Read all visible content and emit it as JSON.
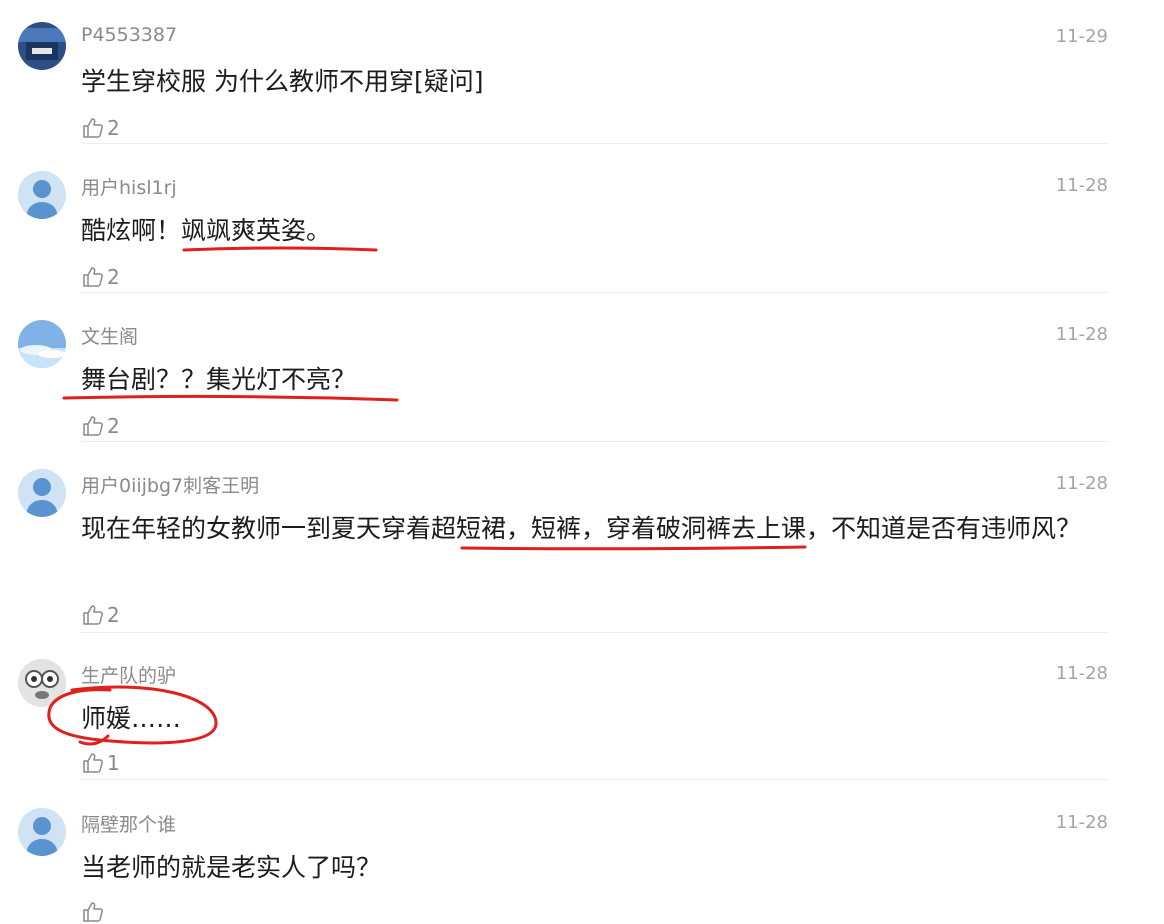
{
  "colors": {
    "annotation": "#e0201a"
  },
  "comments": [
    {
      "avatar_icon": "photo-avatar-icon",
      "username": "P4553387",
      "date": "11-29",
      "text": "学生穿校服 为什么教师不用穿[疑问]",
      "likes": "2"
    },
    {
      "avatar_icon": "default-user-avatar-icon",
      "username": "用户hisl1rj",
      "date": "11-28",
      "text": "酷炫啊！飒飒爽英姿。",
      "likes": "2"
    },
    {
      "avatar_icon": "sky-photo-avatar-icon",
      "username": "文生阁",
      "date": "11-28",
      "text": "舞台剧？？集光灯不亮？",
      "likes": "2"
    },
    {
      "avatar_icon": "default-user-avatar-icon",
      "username": "用户0iijbg7刺客王明",
      "date": "11-28",
      "text": "现在年轻的女教师一到夏天穿着超短裙，短裤，穿着破洞裤去上课，不知道是否有违师风？",
      "likes": "2"
    },
    {
      "avatar_icon": "cartoon-face-avatar-icon",
      "username": "生产队的驴",
      "date": "11-28",
      "text": "师媛……",
      "likes": "1"
    },
    {
      "avatar_icon": "default-user-avatar-icon",
      "username": "隔壁那个谁",
      "date": "11-28",
      "text": "当老师的就是老实人了吗？",
      "likes": ""
    }
  ]
}
